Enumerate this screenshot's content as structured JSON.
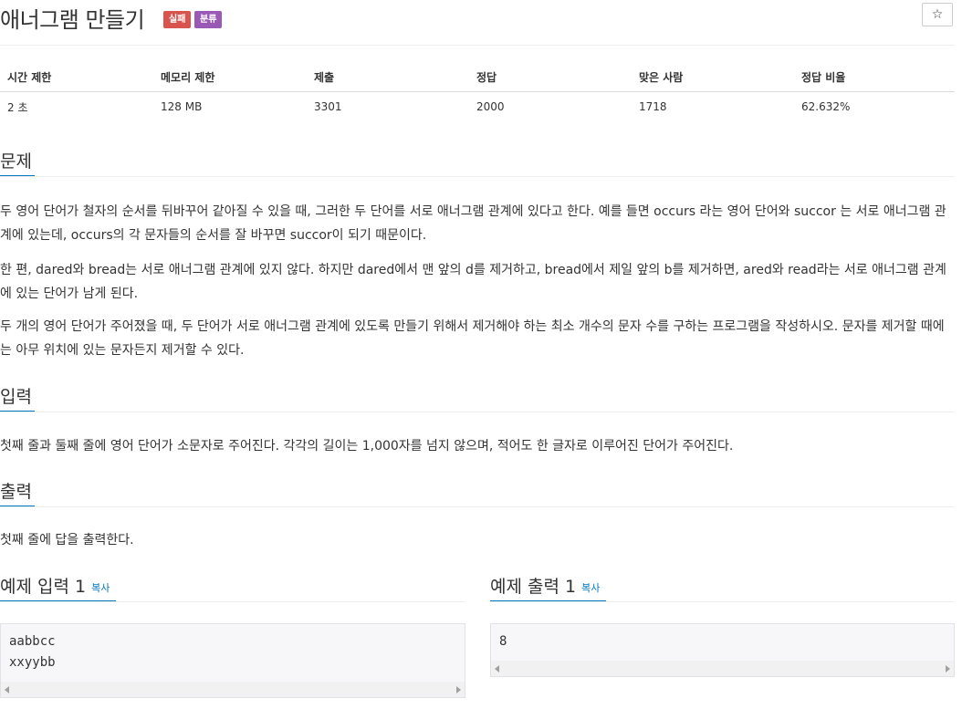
{
  "problem": {
    "title": "애너그램 만들기",
    "badges": {
      "fail": "실패",
      "category": "분류"
    },
    "star_icon": "☆"
  },
  "info_table": {
    "headers": [
      "시간 제한",
      "메모리 제한",
      "제출",
      "정답",
      "맞은 사람",
      "정답 비율"
    ],
    "values": [
      "2 초",
      "128 MB",
      "3301",
      "2000",
      "1718",
      "62.632%"
    ]
  },
  "description": {
    "title": "문제",
    "p1": "두 영어 단어가 철자의 순서를 뒤바꾸어 같아질 수 있을 때, 그러한 두 단어를 서로 애너그램 관계에 있다고 한다. 예를 들면 occurs 라는 영어 단어와 succor 는 서로 애너그램 관계에 있는데, occurs의 각 문자들의 순서를 잘 바꾸면 succor이 되기 때문이다.",
    "p2": "한 편, dared와 bread는 서로 애너그램 관계에 있지 않다. 하지만 dared에서 맨 앞의 d를 제거하고, bread에서 제일 앞의 b를 제거하면, ared와 read라는 서로 애너그램 관계에 있는 단어가 남게 된다.",
    "p3": "두 개의 영어 단어가 주어졌을 때, 두 단어가 서로 애너그램 관계에 있도록 만들기 위해서 제거해야 하는 최소 개수의 문자 수를 구하는 프로그램을 작성하시오. 문자를 제거할 때에는 아무 위치에 있는 문자든지 제거할 수 있다."
  },
  "input": {
    "title": "입력",
    "text": "첫째 줄과 둘째 줄에 영어 단어가 소문자로 주어진다. 각각의 길이는 1,000자를 넘지 않으며, 적어도 한 글자로 이루어진 단어가 주어진다."
  },
  "output": {
    "title": "출력",
    "text": "첫째 줄에 답을 출력한다."
  },
  "sample_input": {
    "title": "예제 입력 1",
    "copy_label": "복사",
    "content": "aabbcc\nxxyybb"
  },
  "sample_output": {
    "title": "예제 출력 1",
    "copy_label": "복사",
    "content": "8"
  },
  "colors": {
    "accent": "#0076c0",
    "fail_badge": "#d9534f",
    "category_badge": "#9b59b6"
  }
}
